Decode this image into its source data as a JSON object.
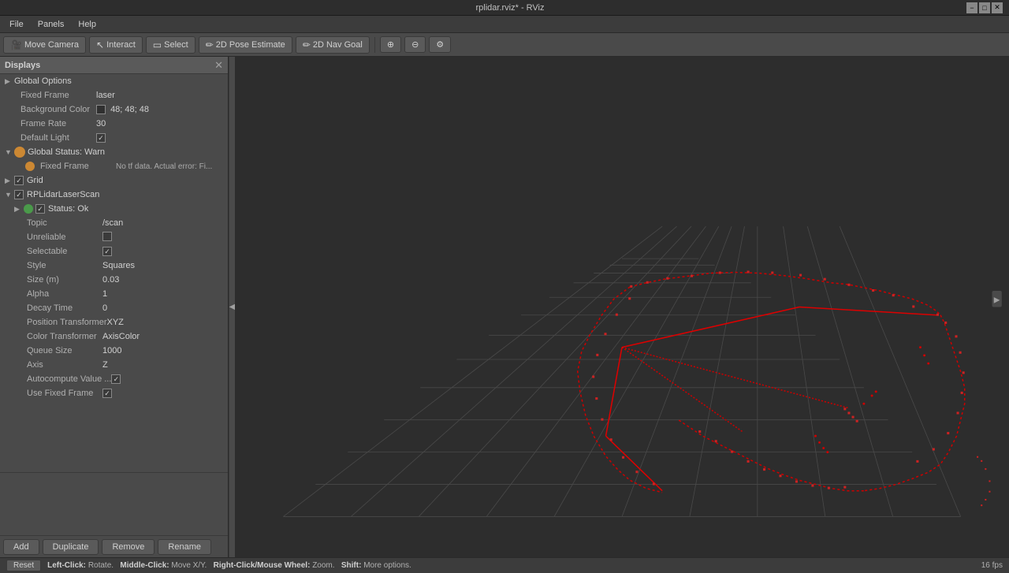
{
  "titlebar": {
    "title": "rplidar.rviz* - RViz",
    "minimize": "−",
    "maximize": "□",
    "close": "✕"
  },
  "menubar": {
    "items": [
      "File",
      "Panels",
      "Help"
    ]
  },
  "toolbar": {
    "move_camera": "Move Camera",
    "interact": "Interact",
    "select": "Select",
    "pose_estimate": "2D Pose Estimate",
    "nav_goal": "2D Nav Goal"
  },
  "displays_panel": {
    "title": "Displays",
    "close": "✕",
    "global_options": "Global Options",
    "fixed_frame_label": "Fixed Frame",
    "fixed_frame_value": "laser",
    "bg_color_label": "Background Color",
    "bg_color_value": "48; 48; 48",
    "frame_rate_label": "Frame Rate",
    "frame_rate_value": "30",
    "default_light_label": "Default Light",
    "default_light_value": "✓",
    "global_status_label": "Global Status: Warn",
    "fixed_frame_warn_label": "Fixed Frame",
    "fixed_frame_warn_value": "No tf data.  Actual error: Fi...",
    "grid_label": "Grid",
    "grid_check": "✓",
    "rplidar_label": "RPLidarLaserScan",
    "rplidar_check": "✓",
    "status_ok_label": "Status: Ok",
    "status_ok_check": "✓",
    "topic_label": "Topic",
    "topic_value": "/scan",
    "unreliable_label": "Unreliable",
    "selectable_label": "Selectable",
    "selectable_value": "✓",
    "style_label": "Style",
    "style_value": "Squares",
    "size_label": "Size (m)",
    "size_value": "0.03",
    "alpha_label": "Alpha",
    "alpha_value": "1",
    "decay_time_label": "Decay Time",
    "decay_time_value": "0",
    "position_transformer_label": "Position Transformer",
    "position_transformer_value": "XYZ",
    "color_transformer_label": "Color Transformer",
    "color_transformer_value": "AxisColor",
    "queue_size_label": "Queue Size",
    "queue_size_value": "1000",
    "axis_label": "Axis",
    "axis_value": "Z",
    "autocompute_label": "Autocompute Value ...",
    "autocompute_value": "✓",
    "use_fixed_frame_label": "Use Fixed Frame",
    "use_fixed_frame_value": "✓"
  },
  "buttons": {
    "add": "Add",
    "duplicate": "Duplicate",
    "remove": "Remove",
    "rename": "Rename",
    "reset": "Reset"
  },
  "statusbar": {
    "reset": "Reset",
    "left_click": "Left-Click:",
    "left_click_val": "Rotate.",
    "middle_click": "Middle-Click:",
    "middle_click_val": "Move X/Y.",
    "right_click": "Right-Click/Mouse Wheel:",
    "right_click_val": "Zoom.",
    "shift": "Shift:",
    "shift_val": "More options.",
    "fps": "16 fps"
  }
}
